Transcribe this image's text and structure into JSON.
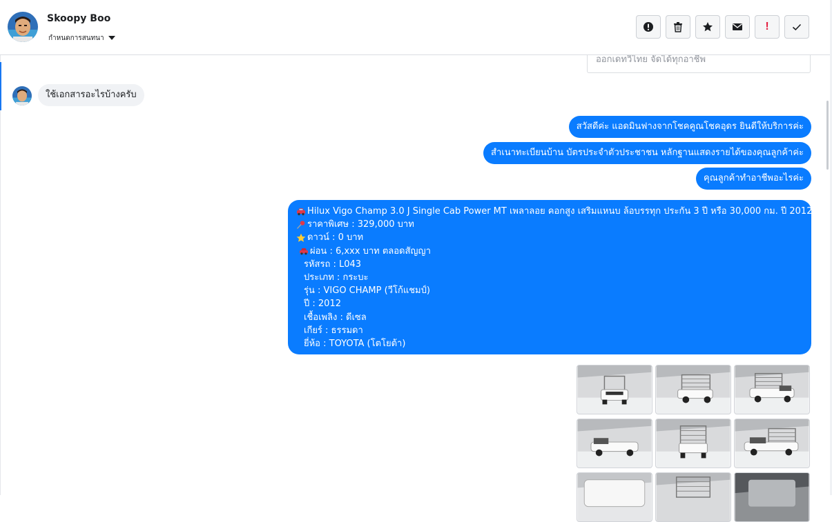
{
  "header": {
    "contact_name": "Skoopy Boo",
    "assign_label": "กำหนดการสนทนา",
    "toolbar": [
      {
        "name": "spam-alert-button",
        "icon": "alert-circle-icon"
      },
      {
        "name": "delete-button",
        "icon": "trash-icon"
      },
      {
        "name": "star-button",
        "icon": "star-icon"
      },
      {
        "name": "mark-unread-button",
        "icon": "envelope-icon"
      },
      {
        "name": "priority-button",
        "icon": "exclamation-icon"
      },
      {
        "name": "mark-done-button",
        "icon": "check-icon"
      }
    ]
  },
  "conversation": {
    "quoted_snippet": "ออกเดทวิไทย จัดได้ทุกอาชีพ",
    "incoming": [
      {
        "text": "ใช้เอกสารอะไรบ้างครับ"
      }
    ],
    "outgoing": [
      {
        "text": "สวัสดีค่ะ แอดมินฟางจากโชคคูณโชคอุดร ยินดีให้บริการค่ะ"
      },
      {
        "text": "สำเนาทะเบียนบ้าน บัตรประจำตัวประชาชน หลักฐานแสดงรายได้ของคุณลูกค้าค่ะ"
      },
      {
        "text": "คุณลูกค้าทำอาชีพอะไรค่ะ"
      }
    ],
    "listing": {
      "lines": [
        {
          "emoji": "car-icon",
          "text": "Hilux Vigo Champ 3.0 J Single Cab Power MT เพลาลอย คอกสูง เสริมแหนบ ล้อบรรทุก ประกัน 3 ปี หรือ 30,000 กม. ปี 2012"
        },
        {
          "emoji": "pin-icon",
          "text": " ราคาพิเศษ : 329,000 บาท"
        },
        {
          "emoji": "star-emoji-icon",
          "text": " ดาวน์ : 0 บาท"
        },
        {
          "emoji": "car-icon",
          "text": " ผ่อน : 6,xxx บาท ตลอดสัญญา"
        },
        {
          "emoji": "",
          "text": "รหัสรถ : L043"
        },
        {
          "emoji": "",
          "text": "ประเภท : กระบะ"
        },
        {
          "emoji": "",
          "text": "รุ่น : VIGO CHAMP (วีโก้แชมป์)"
        },
        {
          "emoji": "",
          "text": "ปี : 2012"
        },
        {
          "emoji": "",
          "text": "เชื้อเพลิง : ดีเซล"
        },
        {
          "emoji": "",
          "text": "เกียร์ : ธรรมดา"
        },
        {
          "emoji": "",
          "text": "ยี่ห้อ : TOYOTA (โตโยต้า)"
        }
      ]
    },
    "photos": [
      {
        "name": "truck-photo-front"
      },
      {
        "name": "truck-photo-rear-left"
      },
      {
        "name": "truck-photo-front-right"
      },
      {
        "name": "truck-photo-front-left"
      },
      {
        "name": "truck-photo-rear"
      },
      {
        "name": "truck-photo-side"
      },
      {
        "name": "truck-photo-detail-1"
      },
      {
        "name": "truck-photo-detail-2"
      },
      {
        "name": "truck-photo-detail-3"
      }
    ]
  },
  "colors": {
    "bubble_out": "#0a7cff",
    "bubble_in": "#f0f2f5",
    "accent": "#1877f2"
  }
}
